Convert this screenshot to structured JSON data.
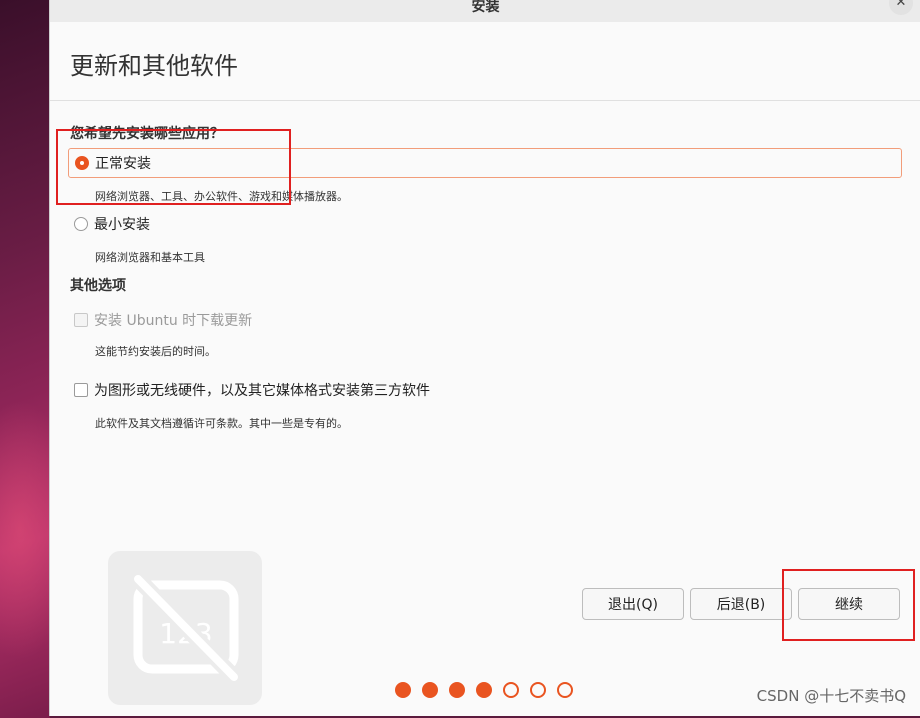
{
  "window": {
    "title": "安装",
    "close_label": "✕"
  },
  "page": {
    "title": "更新和其他软件"
  },
  "install_type": {
    "question": "您希望先安装哪些应用？",
    "options": [
      {
        "label": "正常安装",
        "description": "网络浏览器、工具、办公软件、游戏和媒体播放器。",
        "selected": true
      },
      {
        "label": "最小安装",
        "description": "网络浏览器和基本工具",
        "selected": false
      }
    ]
  },
  "other_options": {
    "heading": "其他选项",
    "items": [
      {
        "label": "安装 Ubuntu 时下载更新",
        "description": "这能节约安装后的时间。",
        "checked": false,
        "disabled": true
      },
      {
        "label": "为图形或无线硬件，以及其它媒体格式安装第三方软件",
        "description": "此软件及其文档遵循许可条款。其中一些是专有的。",
        "checked": false,
        "disabled": false
      }
    ]
  },
  "illustration": {
    "icon": "keyboard-disabled-icon",
    "text": "123"
  },
  "buttons": {
    "quit": "退出(Q)",
    "back": "后退(B)",
    "continue": "继续"
  },
  "progress": {
    "total_steps": 7,
    "completed_steps": 4
  },
  "colors": {
    "accent": "#e95420",
    "annotation": "#e02020"
  },
  "watermark": "CSDN @十七不卖书Q"
}
